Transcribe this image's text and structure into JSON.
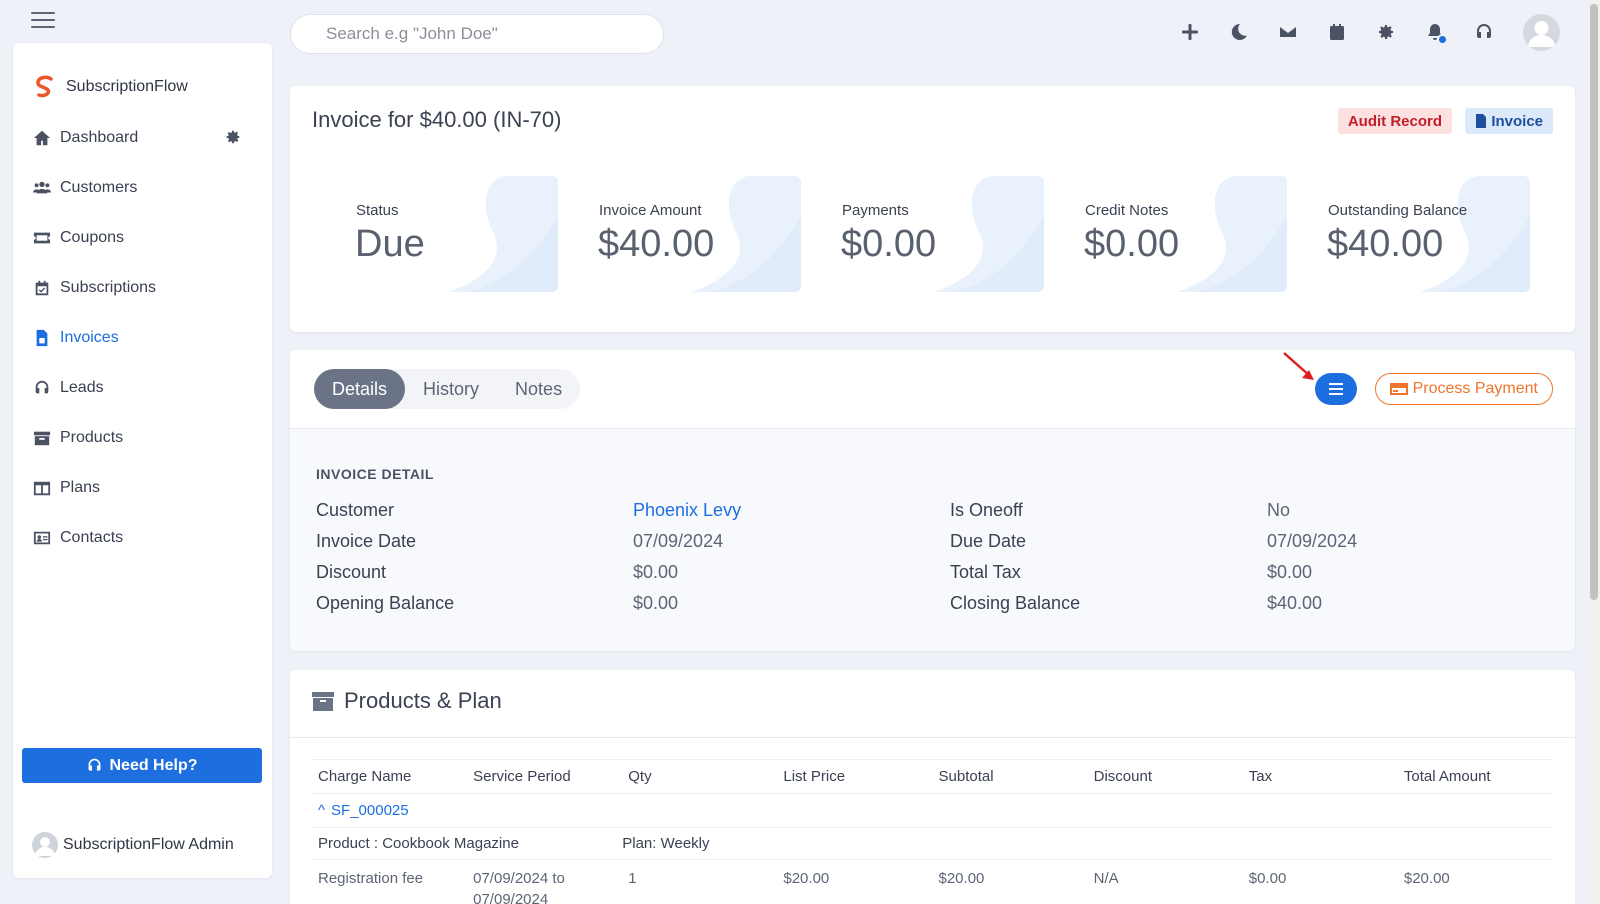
{
  "search": {
    "placeholder": "Search e.g \"John Doe\""
  },
  "topbar": {
    "icons": [
      "plus-icon",
      "moon-icon",
      "mail-icon",
      "calendar-icon",
      "gear-icon",
      "bell-icon",
      "headset-icon"
    ]
  },
  "brand": {
    "name": "SubscriptionFlow"
  },
  "sidebar": {
    "items": [
      {
        "label": "Dashboard",
        "icon": "home-icon"
      },
      {
        "label": "Customers",
        "icon": "users-icon"
      },
      {
        "label": "Coupons",
        "icon": "ticket-icon"
      },
      {
        "label": "Subscriptions",
        "icon": "calendar-check-icon"
      },
      {
        "label": "Invoices",
        "icon": "file-invoice-icon",
        "active": true
      },
      {
        "label": "Leads",
        "icon": "headset-icon"
      },
      {
        "label": "Products",
        "icon": "archive-icon"
      },
      {
        "label": "Plans",
        "icon": "columns-icon"
      },
      {
        "label": "Contacts",
        "icon": "address-card-icon"
      }
    ],
    "help_label": "Need Help?",
    "admin_name": "SubscriptionFlow Admin"
  },
  "invoice": {
    "title": "Invoice for $40.00 (IN-70)",
    "tag_audit": "Audit Record",
    "tag_invoice": "Invoice",
    "stats": [
      {
        "label": "Status",
        "value": "Due"
      },
      {
        "label": "Invoice Amount",
        "value": "$40.00"
      },
      {
        "label": "Payments",
        "value": "$0.00"
      },
      {
        "label": "Credit Notes",
        "value": "$0.00"
      },
      {
        "label": "Outstanding Balance",
        "value": "$40.00"
      }
    ]
  },
  "tabs": [
    "Details",
    "History",
    "Notes"
  ],
  "actions": {
    "process_payment": "Process Payment"
  },
  "detail": {
    "heading": "INVOICE DETAIL",
    "rows": [
      {
        "l1": "Customer",
        "v1": "Phoenix Levy",
        "l2": "Is Oneoff",
        "v2": "No"
      },
      {
        "l1": "Invoice Date",
        "v1": "07/09/2024",
        "l2": "Due Date",
        "v2": "07/09/2024"
      },
      {
        "l1": "Discount",
        "v1": "$0.00",
        "l2": "Total Tax",
        "v2": "$0.00"
      },
      {
        "l1": "Opening Balance",
        "v1": "$0.00",
        "l2": "Closing Balance",
        "v2": "$40.00"
      }
    ]
  },
  "products": {
    "title": "Products & Plan",
    "columns": [
      "Charge Name",
      "Service Period",
      "Qty",
      "List Price",
      "Subtotal",
      "Discount",
      "Tax",
      "Total Amount"
    ],
    "subscription": "SF_000025",
    "product_label": "Product : Cookbook Magazine",
    "plan_label": "Plan: Weekly",
    "row": {
      "charge": "Registration fee",
      "period_line1": "07/09/2024 to",
      "period_line2": "07/09/2024",
      "qty": "1",
      "list_price": "$20.00",
      "subtotal": "$20.00",
      "discount": "N/A",
      "tax": "$0.00",
      "total": "$20.00"
    }
  },
  "colors": {
    "accent": "#1d6fe0",
    "payment": "#f0752c",
    "audit_bg": "#fde1e1",
    "audit_text": "#c0202a"
  }
}
